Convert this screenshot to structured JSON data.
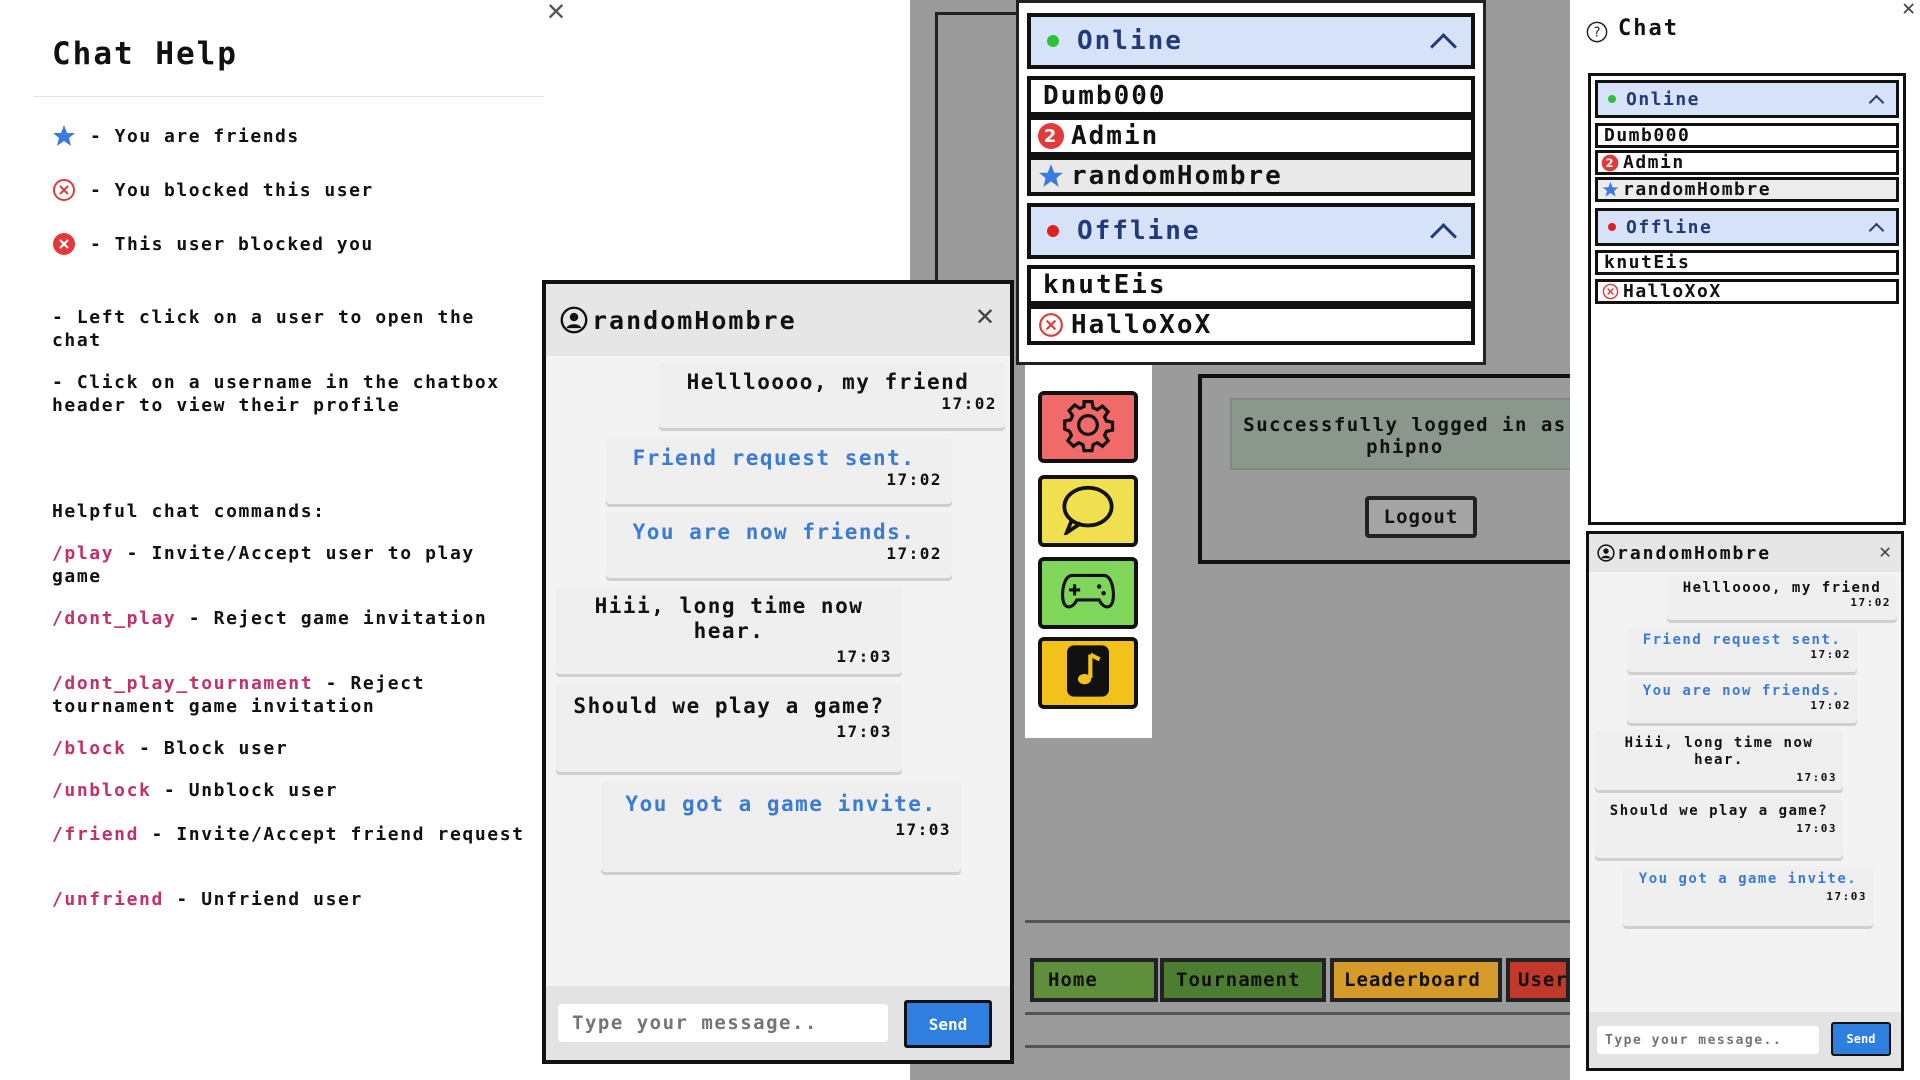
{
  "help": {
    "title": "Chat Help",
    "legend": [
      {
        "icon": "star-icon",
        "text": "- You are friends"
      },
      {
        "icon": "blocked-outline-icon",
        "text": "- You blocked this user"
      },
      {
        "icon": "blocked-filled-icon",
        "text": "- This user blocked you"
      }
    ],
    "tips": [
      "- Left click on a user to open the chat",
      "- Click on a username in the chatbox header to view their profile"
    ],
    "commands_title": "Helpful chat commands:",
    "commands": [
      {
        "cmd": "/play",
        "desc": " - Invite/Accept user to play game"
      },
      {
        "cmd": "/dont_play",
        "desc": " - Reject game invitation"
      },
      {
        "cmd": "/dont_play_tournament",
        "desc": " - Reject tournament game invitation"
      },
      {
        "cmd": "/block",
        "desc": " - Block user"
      },
      {
        "cmd": "/unblock",
        "desc": " - Unblock user"
      },
      {
        "cmd": "/friend",
        "desc": " - Invite/Accept friend request"
      },
      {
        "cmd": "/unfriend",
        "desc": " - Unfriend user"
      }
    ],
    "close": "✕"
  },
  "userlist": {
    "online_label": "Online",
    "offline_label": "Offline",
    "online": [
      {
        "name": "Dumb000",
        "badge": ""
      },
      {
        "name": "Admin",
        "badge": "2"
      },
      {
        "name": "randomHombre",
        "badge": "star"
      }
    ],
    "offline": [
      {
        "name": "knutEis",
        "badge": ""
      },
      {
        "name": "HalloXoX",
        "badge": "blocked"
      }
    ],
    "colors": {
      "online_dot": "#2fbf3a",
      "offline_dot": "#e02020",
      "header_bg": "#d6e2f8"
    }
  },
  "chat": {
    "user": "randomHombre",
    "close": "✕",
    "messages": [
      {
        "text": "Hellloooo, my friend",
        "time": "17:02",
        "kind": "in"
      },
      {
        "text": "Friend request sent.",
        "time": "17:02",
        "kind": "system"
      },
      {
        "text": "You are now friends.",
        "time": "17:02",
        "kind": "system"
      },
      {
        "text": "Hiii, long time now hear.",
        "time": "17:03",
        "kind": "out"
      },
      {
        "text": "Should we play a game?",
        "time": "17:03",
        "kind": "out"
      },
      {
        "text": "You got a game invite.",
        "time": "17:03",
        "kind": "system"
      }
    ],
    "input_placeholder": "Type your message..",
    "send_label": "Send"
  },
  "login": {
    "message": "Successfully logged in as phipno",
    "logout_label": "Logout"
  },
  "nav": {
    "items": [
      "Home",
      "Tournament",
      "Leaderboard",
      "User"
    ],
    "colors": [
      "#5f8f3c",
      "#4d7c33",
      "#d59a28",
      "#c0392b"
    ]
  },
  "right_panel": {
    "title": "Chat",
    "close": "✕"
  },
  "apps": [
    {
      "icon": "gear-icon",
      "color": "#f06a6a"
    },
    {
      "icon": "chat-bubble-icon",
      "color": "#f0df4e"
    },
    {
      "icon": "gamepad-icon",
      "color": "#7fd65a"
    },
    {
      "icon": "music-note-icon",
      "color": "#f2c21b"
    }
  ]
}
